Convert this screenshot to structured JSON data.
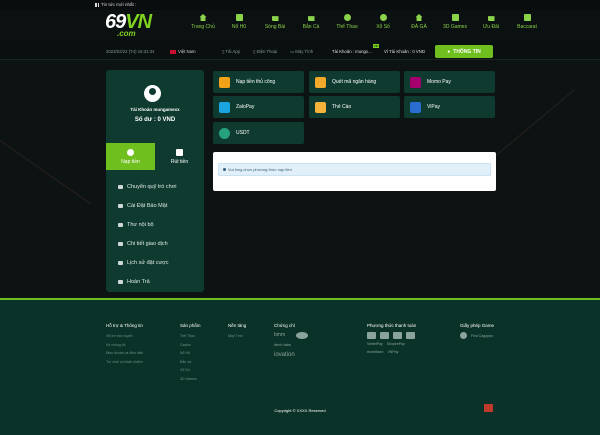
{
  "announcement": {
    "label": "Tin tức mới nhất :"
  },
  "logo": {
    "main_a": "69",
    "main_b": "VN",
    "sub": ".com"
  },
  "nav": [
    {
      "label": "Trang Chủ",
      "icon": "home-icon"
    },
    {
      "label": "Nổ Hũ",
      "icon": "slot-icon"
    },
    {
      "label": "Sòng Bài",
      "icon": "casino-icon"
    },
    {
      "label": "Bắn Cá",
      "icon": "fish-icon"
    },
    {
      "label": "Thể Thao",
      "icon": "soccer-ball-icon"
    },
    {
      "label": "Xổ Số",
      "icon": "lottery-icon"
    },
    {
      "label": "ĐÁ GÀ",
      "icon": "rooster-icon"
    },
    {
      "label": "3D Games",
      "icon": "game-icon"
    },
    {
      "label": "Ưu Đãi",
      "icon": "gift-icon"
    },
    {
      "label": "Baccarat",
      "icon": "cards-icon"
    }
  ],
  "subbar": {
    "datetime": "2023/02/22 (T4) 16:31:34",
    "language": "Việt Nam",
    "app": "Tải App",
    "phone": "Điện Thoại",
    "computer": "Máy Tính",
    "account_label": "Tài Khoản : mungx...",
    "wallet_label": "Ví Tài Khoản : 0 VND",
    "vip_badge": "VIP",
    "info_button": "THÔNG TIN"
  },
  "sidebar": {
    "account": "Tài Khoản mungamexx",
    "balance": "Số dư : 0 VND",
    "tabs": [
      {
        "label": "Nạp tiền",
        "icon": "deposit-icon",
        "active": true
      },
      {
        "label": "Rút tiền",
        "icon": "withdraw-icon",
        "active": false
      }
    ],
    "menu": [
      {
        "label": "Chuyển quỹ trò chơi",
        "icon": "transfer-icon"
      },
      {
        "label": "Cài Đặt Bảo Mật",
        "icon": "security-icon"
      },
      {
        "label": "Thư nội bộ",
        "icon": "mail-icon"
      },
      {
        "label": "Chi tiết giao dịch",
        "icon": "transaction-icon"
      },
      {
        "label": "Lịch sử đặt cược",
        "icon": "history-icon"
      },
      {
        "label": "Hoàn Trả",
        "icon": "rebate-icon"
      }
    ]
  },
  "payment_methods": [
    {
      "label": "Nạp tiền thủ công",
      "icon": "bank-icon",
      "color": "#f4a11a"
    },
    {
      "label": "Quét mã ngân hàng",
      "icon": "qr-icon",
      "color": "#f0a92a"
    },
    {
      "label": "Momo Pay",
      "icon": "momo-icon",
      "color": "#a5006d"
    },
    {
      "label": "ZaloPay",
      "icon": "zalopay-icon",
      "color": "#1aa5e0"
    },
    {
      "label": "Thẻ Cào",
      "icon": "scratch-card-icon",
      "color": "#f6b33b"
    },
    {
      "label": "ViPay",
      "icon": "vipay-icon",
      "color": "#2b6ccf"
    },
    {
      "label": "USDT",
      "icon": "usdt-icon",
      "color": "#26a17b"
    }
  ],
  "panel": {
    "alert": "Vui lòng chọn phương thức nạp tiền"
  },
  "footer": {
    "columns": [
      {
        "heading": "Hỗ trợ & Thông tin",
        "links": [
          "Hỗ trợ trực tuyến",
          "Về chúng tôi",
          "Điều khoản và điều kiện",
          "Trò chơi có trách nhiệm"
        ]
      },
      {
        "heading": "Sản phẩm",
        "links": [
          "Thể Thao",
          "Casino",
          "Nổ Hũ",
          "Bắn cá",
          "Xổ Số",
          "3D Games"
        ]
      },
      {
        "heading": "Nền tảng",
        "links": [
          "Máy Tính"
        ]
      },
      {
        "heading": "Chứng chỉ",
        "links": [
          "bmm",
          "itech labs",
          "iovation"
        ]
      },
      {
        "heading": "Phương thức thanh toán",
        "links": [
          "ViettelPay",
          "VNPay",
          "ShopeePay",
          "mobifone"
        ]
      },
      {
        "heading": "Giấy phép Game",
        "links": [
          "First Cagayan"
        ]
      }
    ],
    "copyright": "Copyright © XXXX Reserved"
  },
  "colors": {
    "accent": "#6fbf1f",
    "panel": "#0f3a30",
    "footer": "#0b3228"
  }
}
